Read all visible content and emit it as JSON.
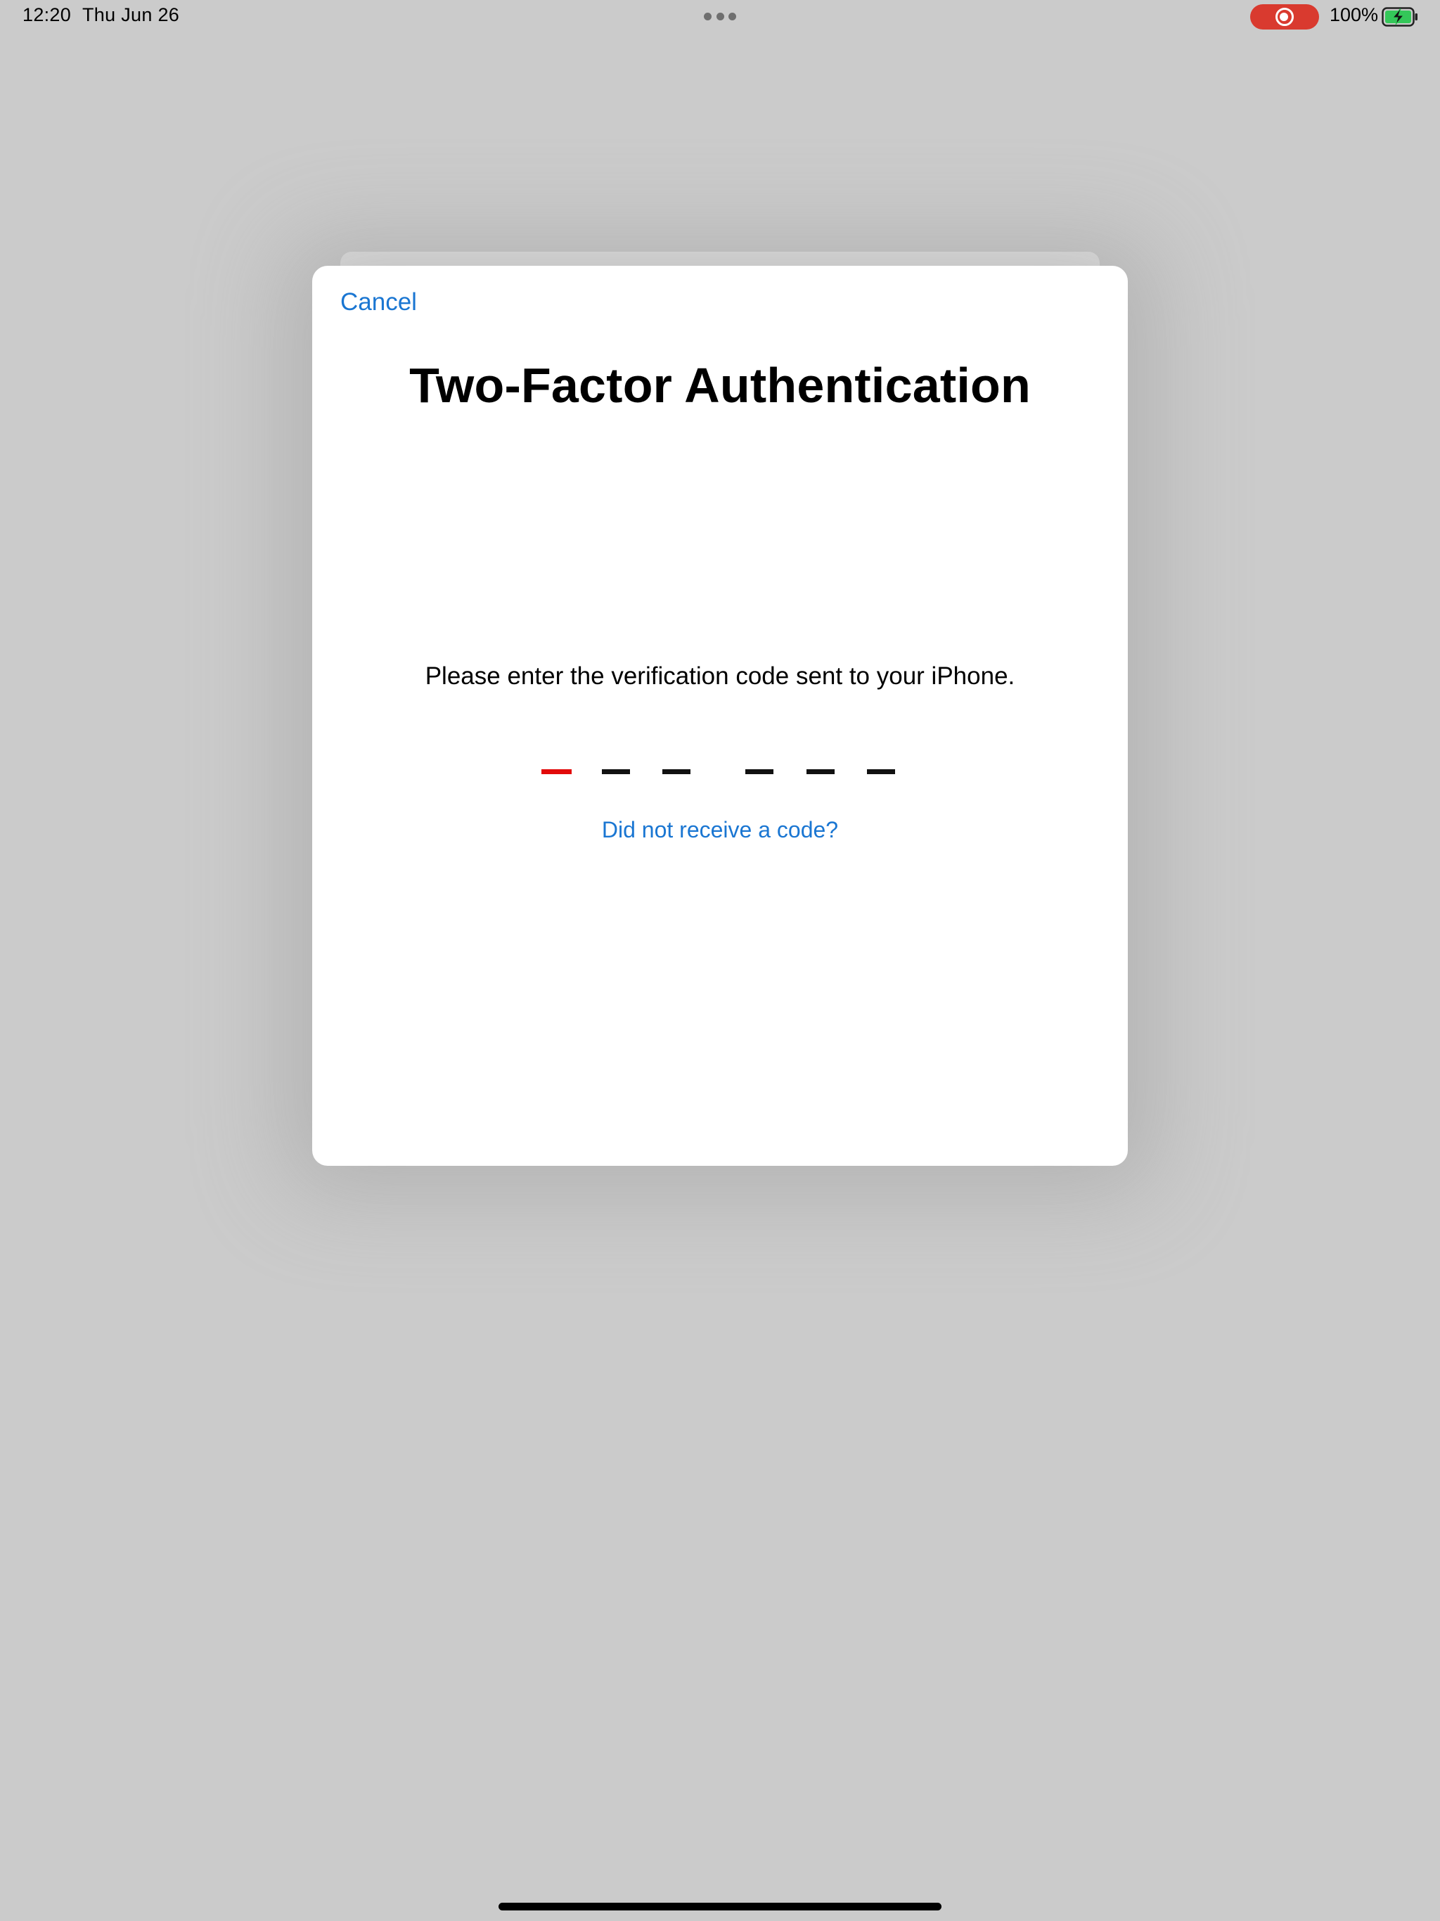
{
  "status_bar": {
    "time": "12:20",
    "date": "Thu Jun 26",
    "battery_percent": "100%",
    "battery_level": 1.0,
    "charging": true,
    "recording_indicator_color": "#d93a2f",
    "icons": [
      "multitasking-dots-icon",
      "screen-recording-icon",
      "battery-charging-icon"
    ]
  },
  "dialog": {
    "cancel_label": "Cancel",
    "title": "Two-Factor Authentication",
    "instructions": "Please enter the verification code sent to your iPhone.",
    "code": {
      "digit_count": 6,
      "entered_digits": "",
      "active_slot": 1,
      "active_color": "#e20a0a"
    },
    "resend_link": "Did not receive a code?"
  },
  "colors": {
    "background": "#cbcbcb",
    "accent_blue": "#1a76d2",
    "battery_green": "#34c759"
  }
}
